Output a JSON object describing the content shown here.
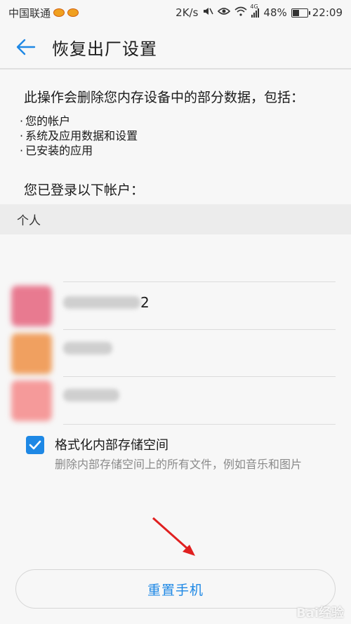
{
  "status_bar": {
    "carrier": "中国联通",
    "speed": "2K/s",
    "network": "4G",
    "battery_text": "48%",
    "battery_level": 0.48,
    "time": "22:09"
  },
  "header": {
    "title": "恢复出厂设置"
  },
  "intro_text": "此操作会删除您内存设备中的部分数据，包括：",
  "bullets": [
    "您的帐户",
    "系统及应用数据和设置",
    "已安装的应用"
  ],
  "logged_in_text": "您已登录以下帐户：",
  "section": {
    "label": "个人"
  },
  "accounts": [
    {
      "name_suffix": "2",
      "avatar_color": "#e87a90"
    },
    {
      "name_suffix": "",
      "avatar_color": "#f0a060"
    },
    {
      "name_suffix": "",
      "avatar_color": "#f59a9a"
    }
  ],
  "format_option": {
    "checked": true,
    "title": "格式化内部存储空间",
    "description": "删除内部存储空间上的所有文件，例如音乐和图片"
  },
  "reset_button": {
    "label": "重置手机"
  },
  "watermark": "Bai经验",
  "colors": {
    "accent": "#1e88e5",
    "annotation_arrow": "#e02020"
  }
}
